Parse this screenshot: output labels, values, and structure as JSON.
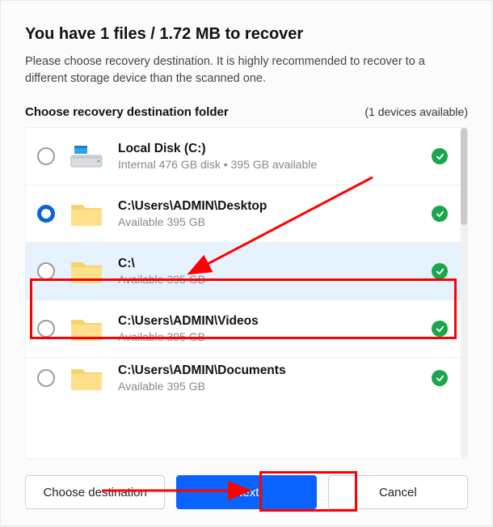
{
  "header": {
    "title": "You have 1 files / 1.72 MB to recover",
    "subtitle": "Please choose recovery destination. It is highly recommended to recover to a different storage device than the scanned one."
  },
  "section": {
    "title": "Choose recovery destination folder",
    "devices_label": "(1 devices available)"
  },
  "rows": [
    {
      "title": "Local Disk (C:)",
      "sub": "Internal 476 GB disk • 395 GB available",
      "icon": "disk",
      "selected": false,
      "ok": true
    },
    {
      "title": "C:\\Users\\ADMIN\\Desktop",
      "sub": "Available 395 GB",
      "icon": "folder",
      "selected": true,
      "ok": true
    },
    {
      "title": "C:\\",
      "sub": "Available 395 GB",
      "icon": "folder",
      "selected": false,
      "ok": true,
      "highlighted": true
    },
    {
      "title": "C:\\Users\\ADMIN\\Videos",
      "sub": "Available 395 GB",
      "icon": "folder",
      "selected": false,
      "ok": true
    },
    {
      "title": "C:\\Users\\ADMIN\\Documents",
      "sub": "Available 395 GB",
      "icon": "folder",
      "selected": false,
      "ok": true
    }
  ],
  "buttons": {
    "choose": "Choose destination",
    "next": "Next",
    "cancel": "Cancel"
  }
}
